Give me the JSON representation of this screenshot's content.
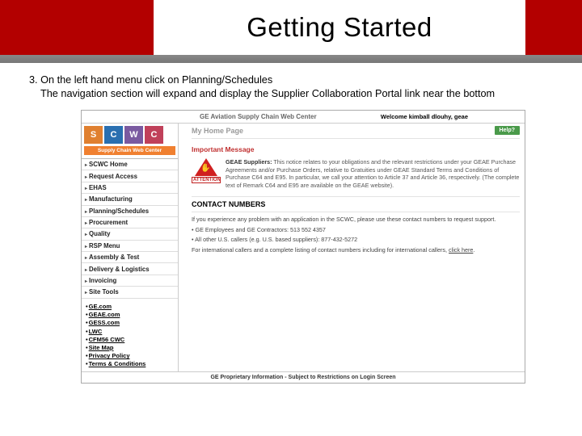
{
  "slide": {
    "title": "Getting Started",
    "instruction_number": "3.",
    "instruction_line1": "On the left hand menu click on Planning/Schedules",
    "instruction_line2": "The navigation section will expand and display the Supplier Collaboration Portal link near the bottom"
  },
  "screenshot": {
    "header_center": "GE Aviation Supply Chain Web Center",
    "welcome": "Welcome kimball dlouhy, geae",
    "logo": {
      "s": "S",
      "c": "C",
      "w": "W",
      "c2": "C",
      "sub": "Supply Chain Web Center"
    },
    "menu": [
      "SCWC Home",
      "Request Access",
      "EHAS",
      "Manufacturing",
      "Planning/Schedules",
      "Procurement",
      "Quality",
      "RSP Menu",
      "Assembly & Test",
      "Delivery & Logistics",
      "Invoicing",
      "Site Tools"
    ],
    "links": [
      "GE.com",
      "GEAE.com",
      "GESS.com",
      "LWC",
      "CFM56 CWC",
      "Site Map",
      "Privacy Policy",
      "Terms & Conditions"
    ],
    "home_title": "My Home Page",
    "help": "Help?",
    "important_msg": "Important Message",
    "attention_label": "ATTENTION",
    "attention_text_bold": "GEAE Suppliers:",
    "attention_text": "This notice relates to your obligations and the relevant restrictions under your GEAE Purchase Agreements and/or Purchase Orders, relative to Gratuities under GEAE Standard Terms and Conditions of Purchase C64 and E95. In particular, we call your attention to Article 37 and Article 36, respectively. (The complete text of Remark C64 and E95 are available on the GEAE website).",
    "contact_hdr": "CONTACT NUMBERS",
    "contact_intro": "If you experience any problem with an application in the SCWC, please use these contact numbers to request support.",
    "contact_b1": "•  GE Employees and GE Contractors: 513 552 4357",
    "contact_b2": "•  All other U.S. callers (e.g. U.S. based suppliers): 877-432-5272",
    "contact_b3_pre": "For international callers and a complete listing of contact numbers including for international callers, ",
    "contact_b3_link": "click here",
    "footer": "GE Proprietary Information - Subject to Restrictions on Login Screen"
  }
}
